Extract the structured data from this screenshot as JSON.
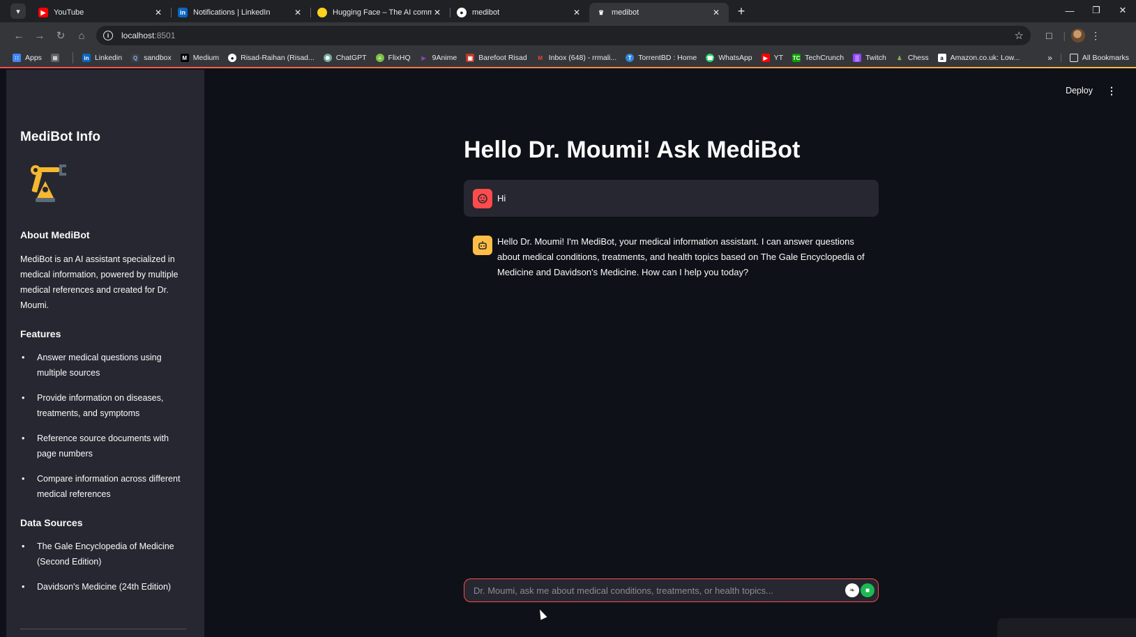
{
  "browser": {
    "tabs": [
      {
        "title": "YouTube",
        "icon": "youtube-icon",
        "color": "#ff0000"
      },
      {
        "title": "Notifications | LinkedIn",
        "icon": "linkedin-icon",
        "color": "#0a66c2"
      },
      {
        "title": "Hugging Face – The AI commu",
        "icon": "hugging-face-icon",
        "color": "#ffd21e"
      },
      {
        "title": "medibot",
        "icon": "streamlit-icon",
        "color": "#ffffff"
      },
      {
        "title": "medibot",
        "icon": "streamlit-icon",
        "color": "#ffffff"
      }
    ],
    "url_host": "localhost",
    "url_port": ":8501",
    "bookmarks": [
      {
        "label": "Apps",
        "icon": "apps-icon",
        "color": "#4285f4"
      },
      {
        "label": "",
        "icon": "grid-icon",
        "color": "#9aa0a6"
      },
      {
        "label": "Linkedin",
        "icon": "linkedin-icon",
        "color": "#0a66c2"
      },
      {
        "label": "sandbox",
        "icon": "search-icon",
        "color": "#8ab4f8"
      },
      {
        "label": "Medium",
        "icon": "medium-icon",
        "color": "#000000"
      },
      {
        "label": "Risad-Raihan (Risad...",
        "icon": "github-icon",
        "color": "#ffffff"
      },
      {
        "label": "ChatGPT",
        "icon": "chatgpt-icon",
        "color": "#74aa9c"
      },
      {
        "label": "FlixHQ",
        "icon": "flixhq-icon",
        "color": "#7bc043"
      },
      {
        "label": "9Anime",
        "icon": "play-icon",
        "color": "#8e44ad"
      },
      {
        "label": "Barefoot Risad",
        "icon": "bookmark-image-icon",
        "color": "#c0392b"
      },
      {
        "label": "Inbox (648) - rrmali...",
        "icon": "gmail-icon",
        "color": "#ea4335"
      },
      {
        "label": "TorrentBD : Home",
        "icon": "torrentbd-icon",
        "color": "#2e86de"
      },
      {
        "label": "WhatsApp",
        "icon": "whatsapp-icon",
        "color": "#25d366"
      },
      {
        "label": "YT",
        "icon": "youtube-icon",
        "color": "#ff0000"
      },
      {
        "label": "TechCrunch",
        "icon": "techcrunch-icon",
        "color": "#0a9e01"
      },
      {
        "label": "Twitch",
        "icon": "twitch-icon",
        "color": "#9146ff"
      },
      {
        "label": "Chess",
        "icon": "chess-icon",
        "color": "#81b64c"
      },
      {
        "label": "Amazon.co.uk: Low...",
        "icon": "amazon-icon",
        "color": "#ffffff"
      }
    ],
    "all_bookmarks": "All Bookmarks"
  },
  "app": {
    "deploy_label": "Deploy",
    "sidebar": {
      "title": "MediBot Info",
      "about_heading": "About MediBot",
      "about_text": "MediBot is an AI assistant specialized in medical information, powered by multiple medical references and created for Dr. Moumi.",
      "features_heading": "Features",
      "features": [
        "Answer medical questions using multiple sources",
        "Provide information on diseases, treatments, and symptoms",
        "Reference source documents with page numbers",
        "Compare information across different medical references"
      ],
      "sources_heading": "Data Sources",
      "sources": [
        "The Gale Encyclopedia of Medicine (Second Edition)",
        "Davidson's Medicine (24th Edition)"
      ]
    },
    "main": {
      "title": "Hello Dr. Moumi! Ask MediBot",
      "messages": [
        {
          "role": "user",
          "text": "Hi"
        },
        {
          "role": "assistant",
          "text": "Hello Dr. Moumi! I'm MediBot, your medical information assistant. I can answer questions about medical conditions, treatments, and health topics based on The Gale Encyclopedia of Medicine and Davidson's Medicine. How can I help you today?"
        }
      ],
      "input_placeholder": "Dr. Moumi, ask me about medical conditions, treatments, or health topics..."
    },
    "colors": {
      "accent_red": "#ff4b4b",
      "accent_yellow": "#ffbd45",
      "background": "#0e1117",
      "sidebar": "#262730"
    }
  }
}
